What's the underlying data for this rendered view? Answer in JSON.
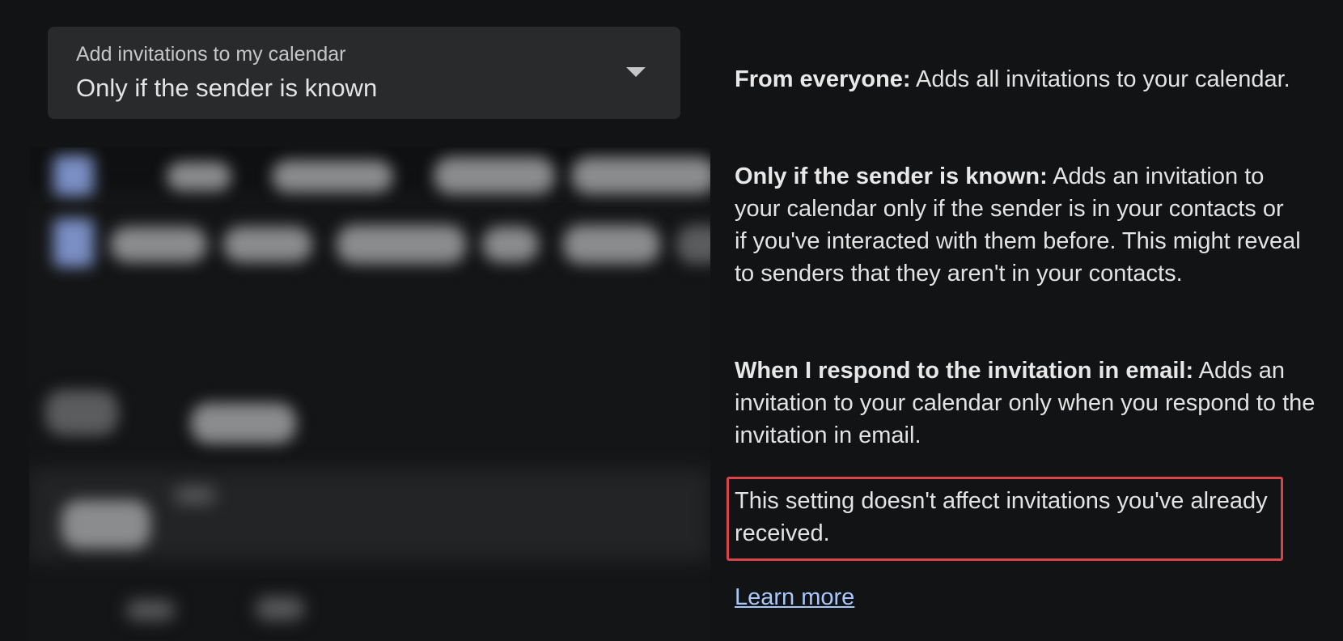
{
  "dropdown": {
    "label": "Add invitations to my calendar",
    "value": "Only if the sender is known",
    "icon": "arrow-drop-down-icon"
  },
  "help": {
    "options": [
      {
        "term": "From everyone:",
        "description": "Adds all invitations to your calendar."
      },
      {
        "term": "Only if the sender is known:",
        "description": "Adds an invitation to your calendar only if the sender is in your contacts or if you've interacted with them before. This might reveal to senders that they aren't in your contacts."
      },
      {
        "term": "When I respond to the invitation in email:",
        "description": "Adds an invitation to your calendar only when you respond to the invitation in email."
      }
    ],
    "note": "This setting doesn't affect invitations you've already received.",
    "learn_more": "Learn more"
  },
  "colors": {
    "background": "#121314",
    "dropdown_bg": "#282a2c",
    "highlight_border": "#d9434a",
    "link": "#a8c7fa"
  }
}
